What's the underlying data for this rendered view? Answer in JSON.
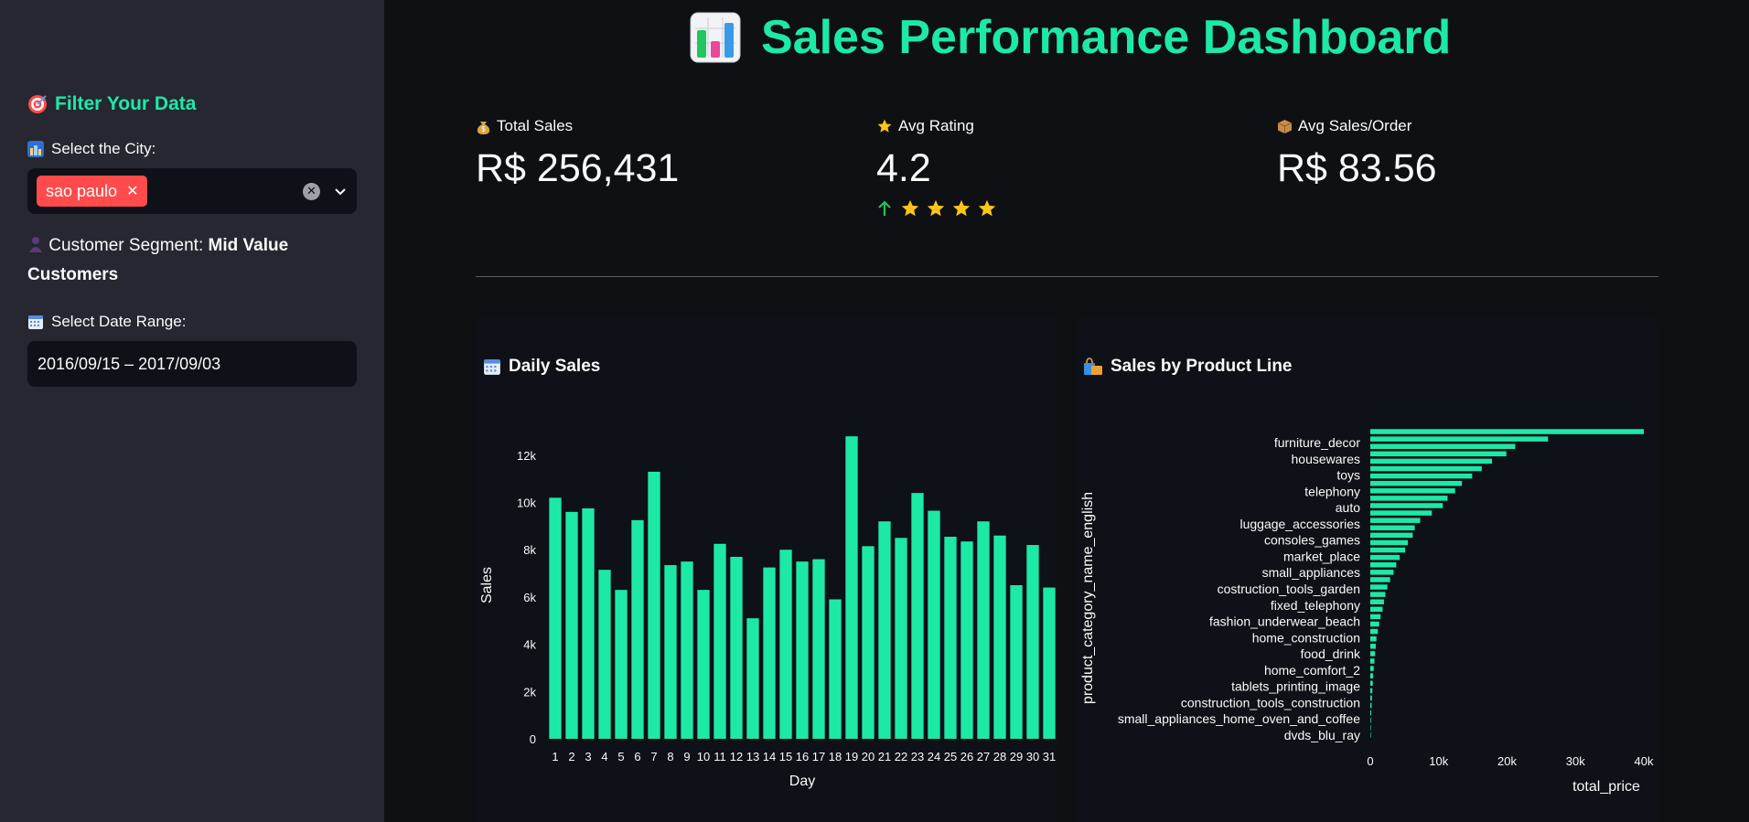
{
  "app": {
    "title": "Sales Performance Dashboard",
    "title_icon": "bar-chart-emoji-icon",
    "accent_color": "#1de9a7"
  },
  "sidebar": {
    "heading": "Filter Your Data",
    "heading_icon": "target-icon",
    "city_label": "Select the City:",
    "city_icon": "cityscape-icon",
    "city_selected": "sao paulo",
    "segment_prefix": "Customer Segment:",
    "segment_value": "Mid Value Customers",
    "segment_icon": "person-silhouette-icon",
    "date_label": "Select Date Range:",
    "date_icon": "calendar-icon",
    "date_value": "2016/09/15 – 2017/09/03"
  },
  "metrics": [
    {
      "label": "Total Sales",
      "value": "R$ 256,431",
      "icon": "money-bag-icon"
    },
    {
      "label": "Avg Rating",
      "value": "4.2",
      "icon": "star-icon",
      "stars": 4,
      "delta_direction": "up"
    },
    {
      "label": "Avg Sales/Order",
      "value": "R$ 83.56",
      "icon": "package-icon"
    }
  ],
  "panels": {
    "daily": {
      "title": "Daily Sales",
      "icon": "calendar-icon"
    },
    "product": {
      "title": "Sales by Product Line",
      "icon": "shopping-bags-icon"
    }
  },
  "chart_data": [
    {
      "type": "bar",
      "title": "Daily Sales",
      "xlabel": "Day",
      "ylabel": "Sales",
      "ylim": [
        0,
        13000
      ],
      "yticks": [
        0,
        2000,
        4000,
        6000,
        8000,
        10000,
        12000
      ],
      "ytick_labels": [
        "0",
        "2k",
        "4k",
        "6k",
        "8k",
        "10k",
        "12k"
      ],
      "categories": [
        "1",
        "2",
        "3",
        "4",
        "5",
        "6",
        "7",
        "8",
        "9",
        "10",
        "11",
        "12",
        "13",
        "14",
        "15",
        "16",
        "17",
        "18",
        "19",
        "20",
        "21",
        "22",
        "23",
        "24",
        "25",
        "26",
        "27",
        "28",
        "29",
        "30",
        "31"
      ],
      "values": [
        10200,
        9600,
        9750,
        7150,
        6300,
        9250,
        11300,
        7350,
        7500,
        6300,
        8250,
        7700,
        5100,
        7250,
        8000,
        7500,
        7600,
        5900,
        12800,
        8150,
        9200,
        8500,
        10400,
        9650,
        8550,
        8350,
        9200,
        8600,
        6500,
        8200,
        6400
      ],
      "color": "#1de9a7",
      "grid": false
    },
    {
      "type": "bar",
      "orientation": "horizontal",
      "title": "Sales by Product Line",
      "xlabel": "total_price",
      "ylabel": "product_category_name_english",
      "xlim": [
        0,
        40000
      ],
      "xticks": [
        0,
        10000,
        20000,
        30000,
        40000
      ],
      "xtick_labels": [
        "0",
        "10k",
        "20k",
        "30k",
        "40k"
      ],
      "categories": [
        "furniture_decor",
        "housewares",
        "toys",
        "telephony",
        "auto",
        "luggage_accessories",
        "consoles_games",
        "market_place",
        "small_appliances",
        "costruction_tools_garden",
        "fixed_telephony",
        "fashion_underwear_beach",
        "home_construction",
        "food_drink",
        "home_comfort_2",
        "tablets_printing_image",
        "construction_tools_construction",
        "small_appliances_home_oven_and_coffee",
        "dvds_blu_ray"
      ],
      "values": [
        40000,
        26000,
        21200,
        19900,
        17800,
        16300,
        14900,
        13400,
        12400,
        11300,
        10600,
        9000,
        7300,
        6500,
        6200,
        5500,
        5100,
        4300,
        3800,
        3400,
        2900,
        2500,
        2200,
        2000,
        1800,
        1500,
        1300,
        1100,
        900,
        800,
        700,
        600,
        500,
        420,
        360,
        300,
        240,
        190,
        140,
        100,
        70,
        40
      ],
      "color": "#1de9a7",
      "grid": false
    }
  ]
}
